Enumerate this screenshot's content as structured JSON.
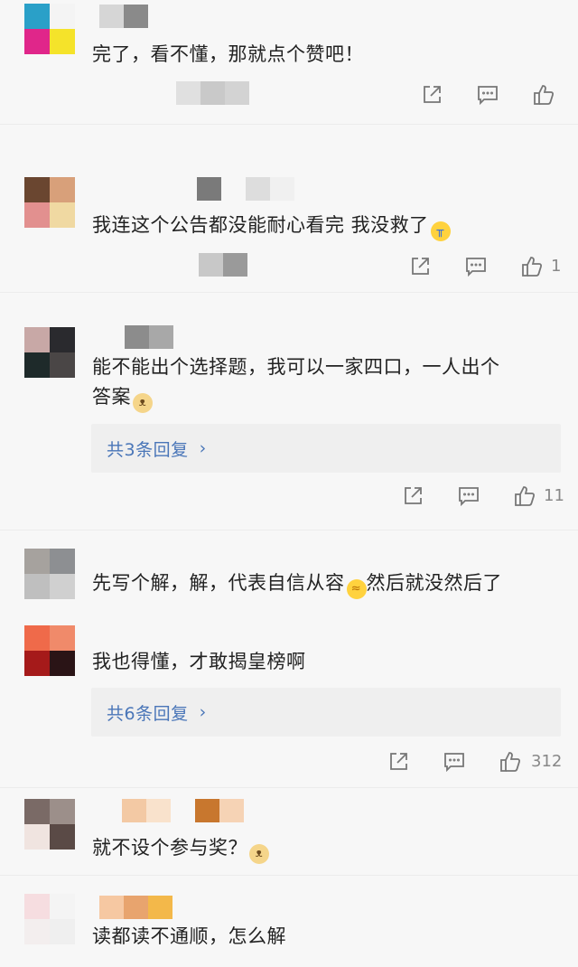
{
  "comments": [
    {
      "text": "完了，看不懂，那就点个赞吧！",
      "like_count": ""
    },
    {
      "text": "我连这个公告都没能耐心看完 我没救了",
      "emoji": "😭",
      "like_count": "1"
    },
    {
      "text_line1": "能不能出个选择题，我可以一家四口，一人出个",
      "text_line2": "答案",
      "emoji": "🐶",
      "reply_label": "共3条回复",
      "like_count": "11"
    },
    {
      "text_before": "先写个解，解，代表自信从容",
      "emoji": "😁",
      "text_after": "然后就没然后了"
    },
    {
      "text": "我也得懂，才敢揭皇榜啊",
      "reply_label": "共6条回复",
      "like_count": "312"
    },
    {
      "text": "就不设个参与奖？",
      "emoji": "🐶"
    },
    {
      "text": "读都读不通顺，怎么解"
    }
  ],
  "icons": {
    "share": "share-icon",
    "comment": "comment-icon",
    "like": "thumbs-up-icon",
    "chevron": "chevron-right-icon"
  },
  "colors": {
    "link": "#4a76b8",
    "background": "#f7f7f7",
    "reply_box": "#efefef"
  }
}
